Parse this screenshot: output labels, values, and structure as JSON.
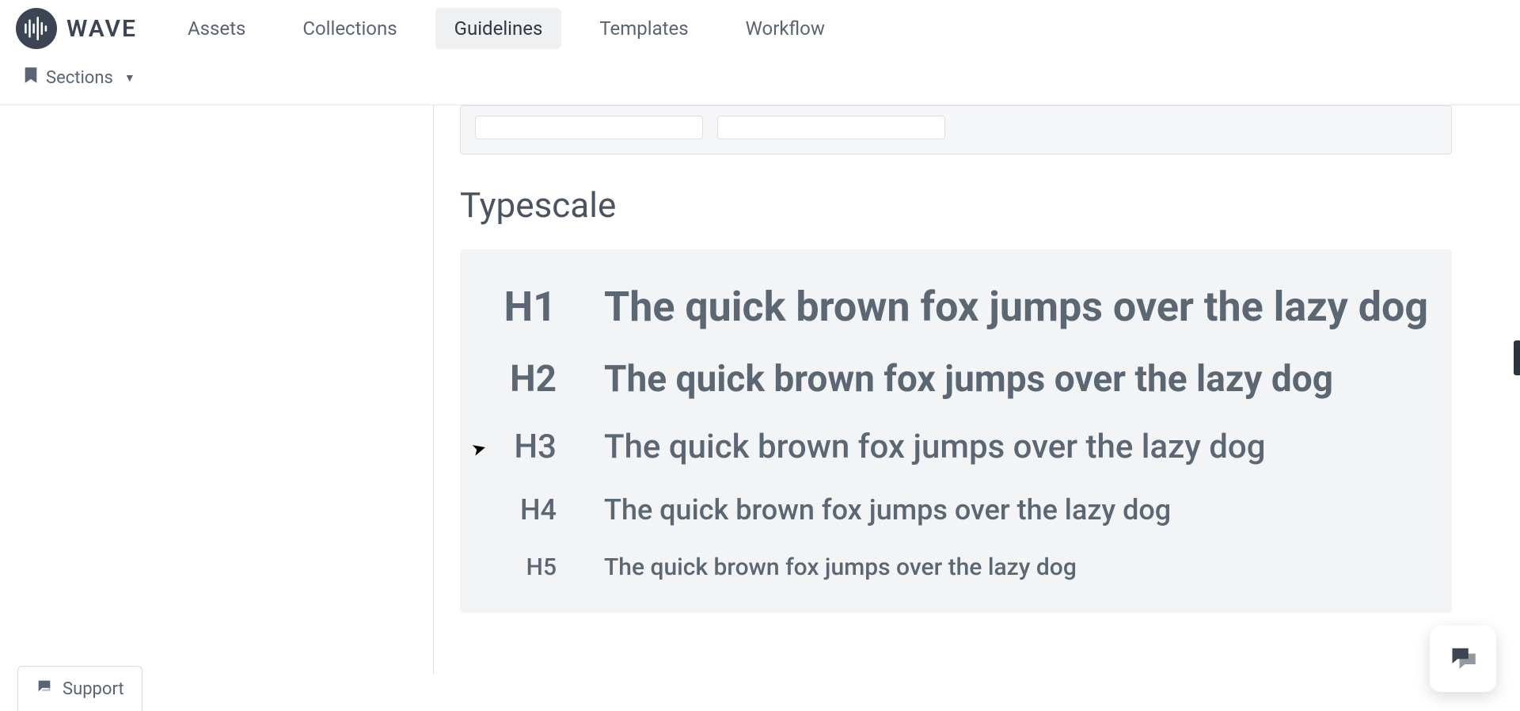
{
  "brand": {
    "name": "WAVE"
  },
  "nav": {
    "items": [
      {
        "label": "Assets"
      },
      {
        "label": "Collections"
      },
      {
        "label": "Guidelines"
      },
      {
        "label": "Templates"
      },
      {
        "label": "Workflow"
      }
    ],
    "active_index": 2
  },
  "subnav": {
    "sections_label": "Sections"
  },
  "content": {
    "typescale": {
      "title": "Typescale",
      "rows": [
        {
          "label": "H1",
          "sample": "The quick brown fox jumps over the lazy dog"
        },
        {
          "label": "H2",
          "sample": "The quick brown fox jumps over the lazy dog"
        },
        {
          "label": "H3",
          "sample": "The quick brown fox jumps over the lazy dog"
        },
        {
          "label": "H4",
          "sample": "The quick brown fox jumps over the lazy dog"
        },
        {
          "label": "H5",
          "sample": "The quick brown fox jumps over the lazy dog"
        }
      ]
    }
  },
  "support": {
    "label": "Support"
  }
}
